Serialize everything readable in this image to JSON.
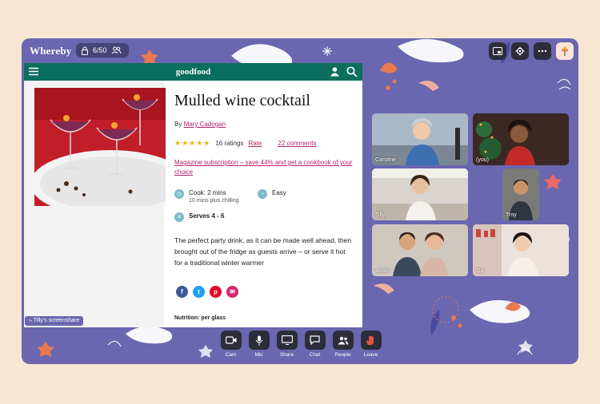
{
  "app": {
    "brand": "Whereby",
    "participants_count": "6/50"
  },
  "shared_page": {
    "site_logo": "goodfood",
    "title": "Mulled wine cocktail",
    "by_prefix": "By",
    "author": "Mary Cadogan",
    "ratings_count": "16 ratings",
    "rating_value": 5,
    "rate_label": "Rate",
    "comments": "22 comments",
    "subscription_link": "Magazine subscription – save 44% and get a cookbook of your choice",
    "cook": "Cook: 2 mins",
    "cook_note": "10 mins plus chilling",
    "difficulty": "Easy",
    "serves": "Serves 4 - 6",
    "description": "The perfect party drink, as it can be made well ahead, then brought out of the fridge as guests arrive – or serve it hot for a traditional winter warmer",
    "nutrition": "Nutrition: per glass",
    "screenshare_label": "Tilly's screenshare"
  },
  "participants": [
    {
      "name": "Caroline"
    },
    {
      "name": "(you)"
    },
    {
      "name": "Tilly"
    },
    {
      "name": "Troy"
    },
    {
      "name": "Anaïs"
    },
    {
      "name": "Tia"
    }
  ],
  "controls": [
    {
      "label": "Cam",
      "icon": "camera-icon"
    },
    {
      "label": "Mic",
      "icon": "microphone-icon"
    },
    {
      "label": "Share",
      "icon": "screen-share-icon"
    },
    {
      "label": "Chat",
      "icon": "chat-icon"
    },
    {
      "label": "People",
      "icon": "people-icon"
    },
    {
      "label": "Leave",
      "icon": "wave-hand-icon"
    }
  ],
  "colors": {
    "room_background": "#6a66b0",
    "page_background": "#f7e6d2",
    "goodfood_header": "#0b6e5f",
    "link_pink": "#b5246d",
    "control_button": "#2d2d3a",
    "leave_button": "#e2583e"
  }
}
